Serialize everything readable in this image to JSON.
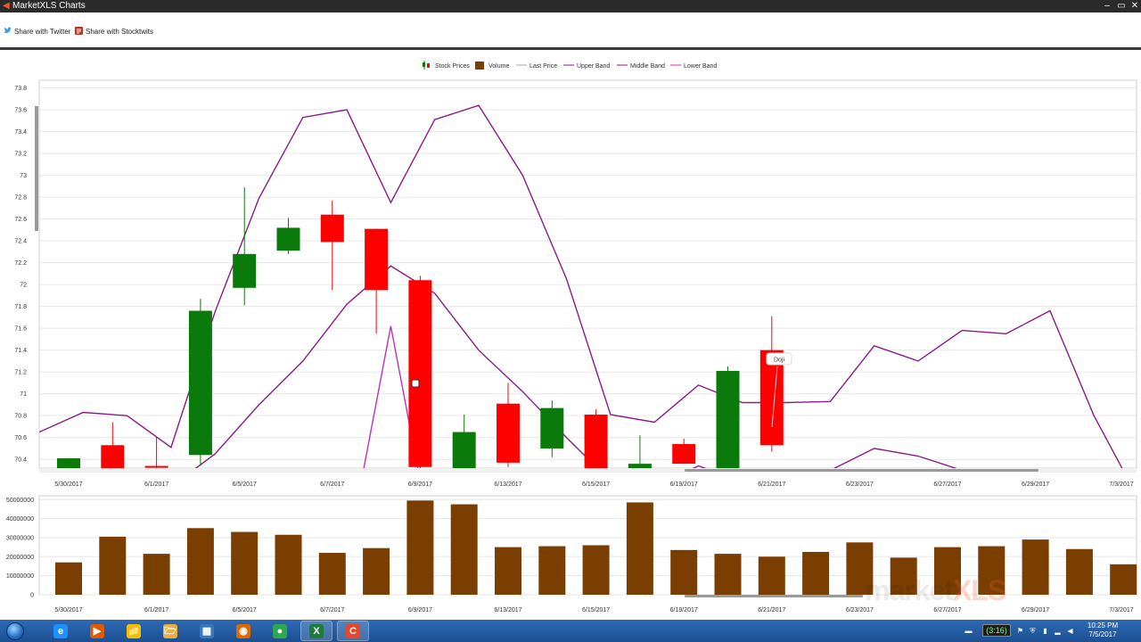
{
  "window": {
    "title": "MarketXLS Charts",
    "controls": [
      "–",
      "▭",
      "✕"
    ]
  },
  "share": {
    "twitter": "Share with Twitter",
    "stocktwits": "Share with Stocktwits"
  },
  "legend": [
    {
      "label": "Stock Prices",
      "kind": "candle"
    },
    {
      "label": "Volume",
      "kind": "box",
      "color": "#7a3e00"
    },
    {
      "label": "Last Price",
      "kind": "line",
      "color": "#aaaaaa"
    },
    {
      "label": "Upper Band",
      "kind": "line",
      "color": "#8b1a8b"
    },
    {
      "label": "Middle Band",
      "kind": "line",
      "color": "#8b1a8b"
    },
    {
      "label": "Lower Band",
      "kind": "line",
      "color": "#c030c0"
    }
  ],
  "annotation": {
    "label": "Doji"
  },
  "colors": {
    "up": "#0a7a0a",
    "down": "#ff0000",
    "volume": "#7a3e00",
    "band": "#8b1a8b",
    "lowerBand": "#c030c0"
  },
  "chart_data": [
    {
      "type": "candlestick",
      "x_tick_labels": [
        "5/30/2017",
        "6/1/2017",
        "6/5/2017",
        "6/7/2017",
        "6/9/2017",
        "6/13/2017",
        "6/15/2017",
        "6/19/2017",
        "6/21/2017",
        "6/23/2017",
        "6/27/2017",
        "6/29/2017",
        "7/3/2017"
      ],
      "y_tick_labels": [
        "70.4",
        "70.6",
        "70.8",
        "71",
        "71.2",
        "71.4",
        "71.6",
        "71.8",
        "72",
        "72.2",
        "72.4",
        "72.6",
        "72.8",
        "73",
        "73.2",
        "73.4",
        "73.6",
        "73.8"
      ],
      "ylim": [
        70.32,
        73.87
      ],
      "candles": [
        {
          "o": 70.32,
          "h": 70.41,
          "l": 70.32,
          "c": 70.41
        },
        {
          "o": 70.53,
          "h": 70.74,
          "l": 70.32,
          "c": 70.32
        },
        {
          "o": 70.34,
          "h": 70.61,
          "l": 70.32,
          "c": 70.33
        },
        {
          "o": 70.44,
          "h": 71.87,
          "l": 70.34,
          "c": 71.76
        },
        {
          "o": 71.97,
          "h": 72.89,
          "l": 71.81,
          "c": 72.28
        },
        {
          "o": 72.31,
          "h": 72.61,
          "l": 72.28,
          "c": 72.52
        },
        {
          "o": 72.64,
          "h": 72.77,
          "l": 71.95,
          "c": 72.39
        },
        {
          "o": 72.51,
          "h": 72.51,
          "l": 71.55,
          "c": 71.95
        },
        {
          "o": 72.04,
          "h": 72.08,
          "l": 70.32,
          "c": 70.33
        },
        {
          "o": 70.32,
          "h": 70.81,
          "l": 70.32,
          "c": 70.65
        },
        {
          "o": 70.91,
          "h": 71.1,
          "l": 70.33,
          "c": 70.37
        },
        {
          "o": 70.5,
          "h": 70.94,
          "l": 70.42,
          "c": 70.87
        },
        {
          "o": 70.81,
          "h": 70.86,
          "l": 70.32,
          "c": 70.32
        },
        {
          "o": 70.32,
          "h": 70.62,
          "l": 70.32,
          "c": 70.36
        },
        {
          "o": 70.54,
          "h": 70.59,
          "l": 70.36,
          "c": 70.36
        },
        {
          "o": 70.32,
          "h": 71.25,
          "l": 70.32,
          "c": 71.21
        },
        {
          "o": 71.4,
          "h": 71.71,
          "l": 70.47,
          "c": 70.53
        }
      ],
      "upper_band": [
        70.65,
        70.83,
        70.8,
        70.51,
        71.75,
        72.79,
        73.53,
        73.6,
        72.75,
        73.51,
        73.64,
        73.0,
        72.05,
        70.81,
        70.74,
        71.08,
        70.92,
        70.92,
        70.93,
        71.44,
        71.3,
        71.58,
        71.55,
        71.76,
        70.8,
        70.05
      ],
      "middle_band": [
        70.0,
        70.05,
        70.1,
        70.15,
        70.45,
        70.9,
        71.3,
        71.82,
        72.17,
        71.92,
        71.4,
        71.02,
        70.6,
        70.2,
        70.15,
        70.34,
        70.2,
        70.22,
        70.3,
        70.5,
        70.43,
        70.3,
        70.2,
        70.1,
        70.0,
        69.9
      ],
      "lower_band": [
        69.0,
        69.0,
        69.0,
        69.0,
        69.0,
        69.0,
        69.0,
        69.5,
        71.62,
        69.5,
        69.0,
        69.0,
        69.0,
        69.0,
        69.0,
        69.0,
        69.0,
        69.0,
        69.0,
        69.0,
        69.0,
        69.0,
        69.0,
        69.0,
        69.0,
        69.0
      ]
    },
    {
      "type": "bar",
      "name": "Volume",
      "y_tick_labels": [
        "0",
        "10000000",
        "20000000",
        "30000000",
        "40000000",
        "50000000"
      ],
      "ylim": [
        0,
        52000000
      ],
      "values": [
        17000000,
        30500000,
        21500000,
        35000000,
        33000000,
        31500000,
        22000000,
        24500000,
        49500000,
        47500000,
        25000000,
        25500000,
        26000000,
        48500000,
        23500000,
        21500000,
        20000000,
        22500000,
        27500000,
        19500000,
        25000000,
        25500000,
        29000000,
        24000000,
        16000000
      ]
    }
  ],
  "taskbar": {
    "apps": [
      "e",
      "▶",
      "📁",
      "🗁",
      "▦",
      "◉",
      "●",
      "X",
      "C"
    ],
    "badge": "(3:16)",
    "time": "10:25 PM",
    "date": "7/5/2017"
  },
  "watermark": {
    "left": "market",
    "right": "XLS"
  }
}
